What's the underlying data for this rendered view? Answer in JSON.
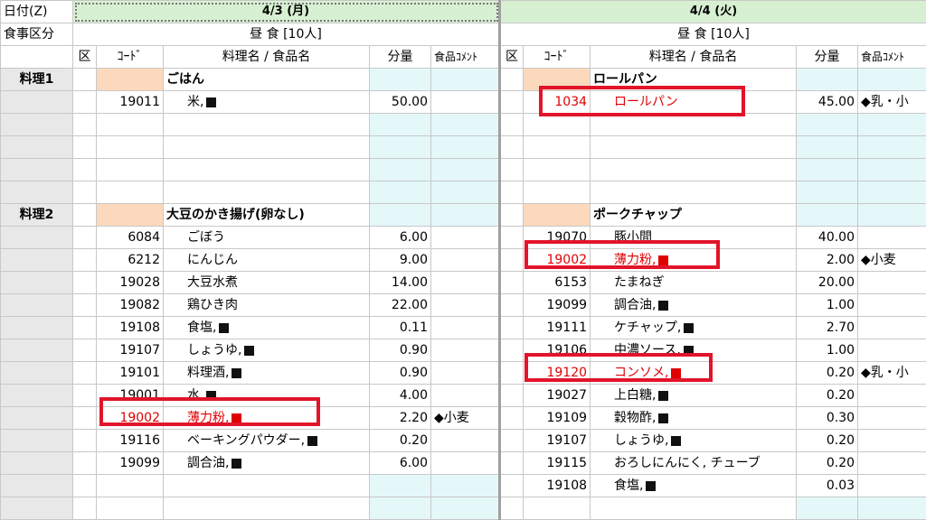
{
  "header": {
    "date_label": "日付(Z)",
    "meal_label": "食事区分",
    "left_date": "4/3 (月)",
    "right_date": "4/4 (火)",
    "left_meal": "昼 食 [10人]",
    "right_meal": "昼 食 [10人]"
  },
  "columns": {
    "ku": "区",
    "code": "ｺｰﾄﾞ",
    "name": "料理名 / 食品名",
    "qty": "分量",
    "comment": "食品ｺﾒﾝﾄ"
  },
  "rows": [
    {
      "label": "料理1",
      "left": {
        "code": "",
        "name": "ごはん",
        "qty": "",
        "comment": "",
        "dish": true
      },
      "right": {
        "code": "",
        "name": "ロールパン",
        "qty": "",
        "comment": "",
        "dish": true
      }
    },
    {
      "label": "",
      "left": {
        "code": "19011",
        "name": "米,",
        "mark": true,
        "qty": "50.00",
        "comment": ""
      },
      "right": {
        "code": "1034",
        "name": "ロールパン",
        "qty": "45.00",
        "comment": "◆乳・小",
        "red": true
      }
    },
    {
      "label": "",
      "left": {
        "code": "",
        "name": "",
        "qty": "",
        "comment": ""
      },
      "right": {
        "code": "",
        "name": "",
        "qty": "",
        "comment": ""
      }
    },
    {
      "label": "",
      "left": {
        "code": "",
        "name": "",
        "qty": "",
        "comment": ""
      },
      "right": {
        "code": "",
        "name": "",
        "qty": "",
        "comment": ""
      }
    },
    {
      "label": "",
      "left": {
        "code": "",
        "name": "",
        "qty": "",
        "comment": ""
      },
      "right": {
        "code": "",
        "name": "",
        "qty": "",
        "comment": ""
      }
    },
    {
      "label": "",
      "left": {
        "code": "",
        "name": "",
        "qty": "",
        "comment": ""
      },
      "right": {
        "code": "",
        "name": "",
        "qty": "",
        "comment": ""
      }
    },
    {
      "label": "料理2",
      "left": {
        "code": "",
        "name": "大豆のかき揚げ(卵なし)",
        "qty": "",
        "comment": "",
        "dish": true
      },
      "right": {
        "code": "",
        "name": "ポークチャップ",
        "qty": "",
        "comment": "",
        "dish": true
      }
    },
    {
      "label": "",
      "left": {
        "code": "6084",
        "name": "ごぼう",
        "qty": "6.00",
        "comment": ""
      },
      "right": {
        "code": "19070",
        "name": "豚小間",
        "qty": "40.00",
        "comment": ""
      }
    },
    {
      "label": "",
      "left": {
        "code": "6212",
        "name": "にんじん",
        "qty": "9.00",
        "comment": ""
      },
      "right": {
        "code": "19002",
        "name": "薄力粉,",
        "mark": true,
        "qty": "2.00",
        "comment": "◆小麦",
        "red": true
      }
    },
    {
      "label": "",
      "left": {
        "code": "19028",
        "name": "大豆水煮",
        "qty": "14.00",
        "comment": ""
      },
      "right": {
        "code": "6153",
        "name": "たまねぎ",
        "qty": "20.00",
        "comment": ""
      }
    },
    {
      "label": "",
      "left": {
        "code": "19082",
        "name": "鶏ひき肉",
        "qty": "22.00",
        "comment": ""
      },
      "right": {
        "code": "19099",
        "name": "調合油,",
        "mark": true,
        "qty": "1.00",
        "comment": ""
      }
    },
    {
      "label": "",
      "left": {
        "code": "19108",
        "name": "食塩,",
        "mark": true,
        "qty": "0.11",
        "comment": ""
      },
      "right": {
        "code": "19111",
        "name": "ケチャップ,",
        "mark": true,
        "qty": "2.70",
        "comment": ""
      }
    },
    {
      "label": "",
      "left": {
        "code": "19107",
        "name": "しょうゆ,",
        "mark": true,
        "qty": "0.90",
        "comment": ""
      },
      "right": {
        "code": "19106",
        "name": "中濃ソース,",
        "mark": true,
        "qty": "1.00",
        "comment": ""
      }
    },
    {
      "label": "",
      "left": {
        "code": "19101",
        "name": "料理酒,",
        "mark": true,
        "qty": "0.90",
        "comment": ""
      },
      "right": {
        "code": "19120",
        "name": "コンソメ,",
        "mark": true,
        "qty": "0.20",
        "comment": "◆乳・小",
        "red": true
      }
    },
    {
      "label": "",
      "left": {
        "code": "19001",
        "name": "水,",
        "mark": true,
        "qty": "4.00",
        "comment": ""
      },
      "right": {
        "code": "19027",
        "name": "上白糖,",
        "mark": true,
        "qty": "0.20",
        "comment": ""
      }
    },
    {
      "label": "",
      "left": {
        "code": "19002",
        "name": "薄力粉,",
        "mark": true,
        "qty": "2.20",
        "comment": "◆小麦",
        "red": true
      },
      "right": {
        "code": "19109",
        "name": "穀物酢,",
        "mark": true,
        "qty": "0.30",
        "comment": ""
      }
    },
    {
      "label": "",
      "left": {
        "code": "19116",
        "name": "ベーキングパウダー,",
        "mark": true,
        "qty": "0.20",
        "comment": ""
      },
      "right": {
        "code": "19107",
        "name": "しょうゆ,",
        "mark": true,
        "qty": "0.20",
        "comment": ""
      }
    },
    {
      "label": "",
      "left": {
        "code": "19099",
        "name": "調合油,",
        "mark": true,
        "qty": "6.00",
        "comment": ""
      },
      "right": {
        "code": "19115",
        "name": "おろしにんにく, チューブ",
        "qty": "0.20",
        "comment": ""
      }
    },
    {
      "label": "",
      "left": {
        "code": "",
        "name": "",
        "qty": "",
        "comment": ""
      },
      "right": {
        "code": "19108",
        "name": "食塩,",
        "mark": true,
        "qty": "0.03",
        "comment": ""
      }
    },
    {
      "label": "",
      "left": {
        "code": "",
        "name": "",
        "qty": "",
        "comment": ""
      },
      "right": {
        "code": "",
        "name": "",
        "qty": "",
        "comment": ""
      }
    }
  ]
}
